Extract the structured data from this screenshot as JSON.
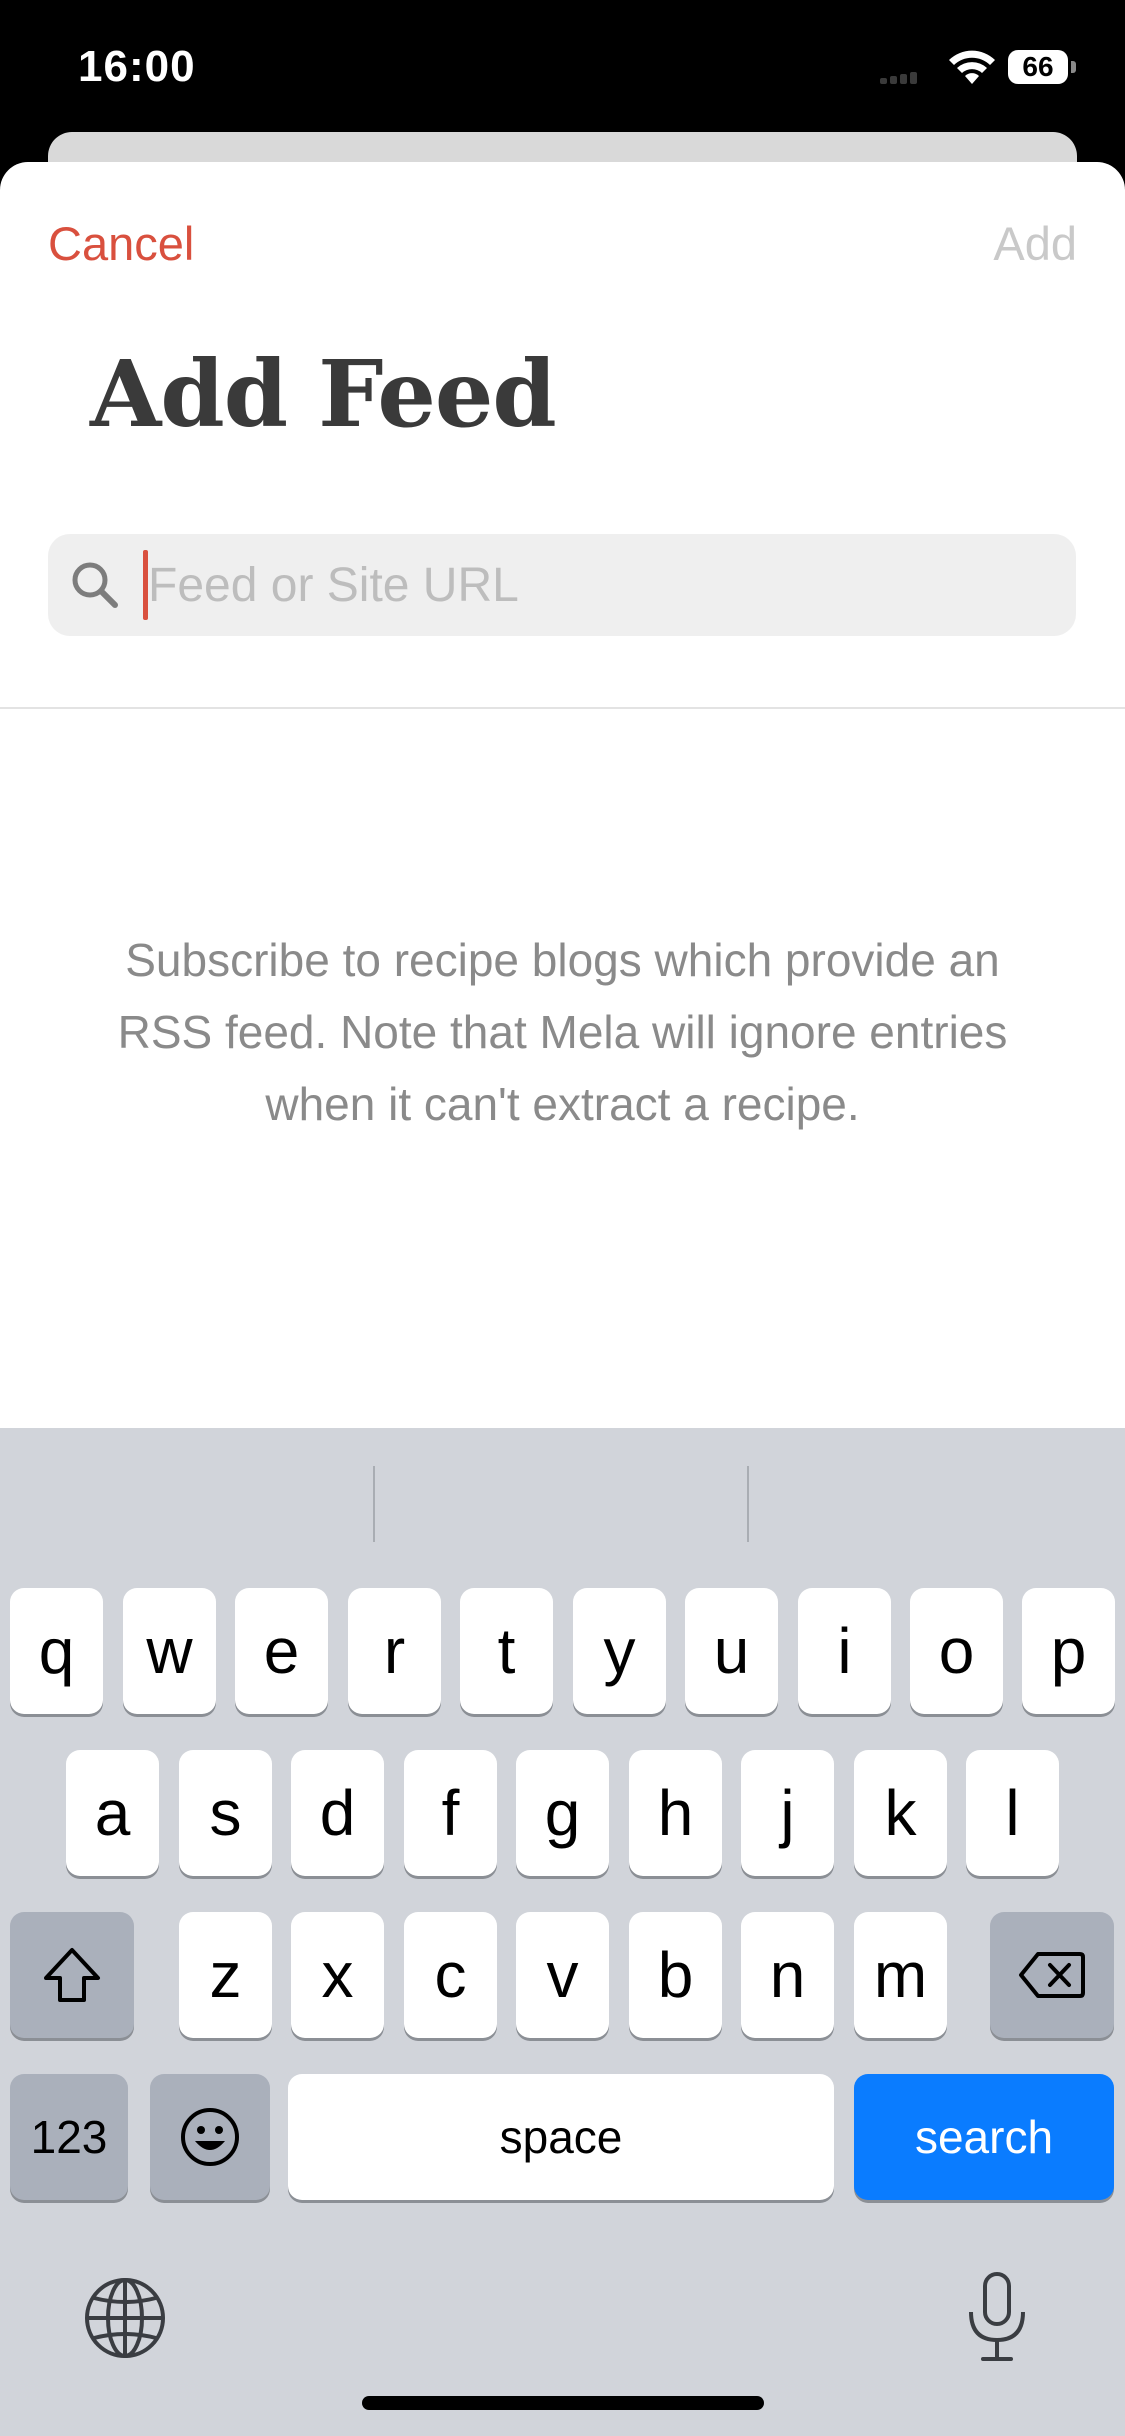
{
  "status_bar": {
    "time": "16:00",
    "battery": "66"
  },
  "nav": {
    "cancel_label": "Cancel",
    "add_label": "Add"
  },
  "page": {
    "title": "Add Feed"
  },
  "search": {
    "placeholder": "Feed or Site URL",
    "value": ""
  },
  "info_text": "Subscribe to recipe blogs which provide an RSS feed. Note that Mela will ignore entries when it can't extract a recipe.",
  "keyboard": {
    "row1": [
      "q",
      "w",
      "e",
      "r",
      "t",
      "y",
      "u",
      "i",
      "o",
      "p"
    ],
    "row2": [
      "a",
      "s",
      "d",
      "f",
      "g",
      "h",
      "j",
      "k",
      "l"
    ],
    "row3": [
      "z",
      "x",
      "c",
      "v",
      "b",
      "n",
      "m"
    ],
    "numbers_label": "123",
    "space_label": "space",
    "action_label": "search"
  },
  "colors": {
    "accent": "#d9503e",
    "keyboard_action": "#0a7cff",
    "keyboard_bg": "#d1d4da"
  }
}
